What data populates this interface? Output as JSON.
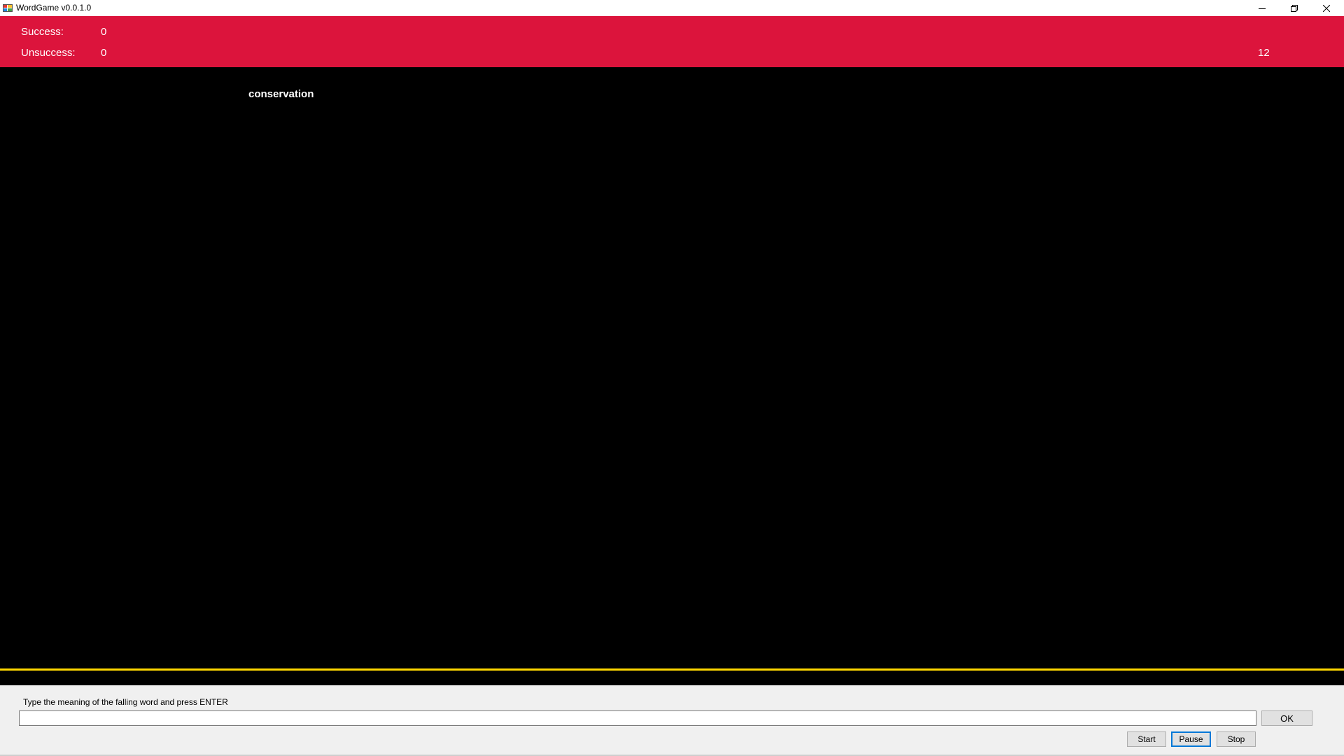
{
  "window": {
    "title": "WordGame v0.0.1.0",
    "app_icon": "app-window-icon",
    "controls": {
      "minimize_icon": "minimize-icon",
      "restore_icon": "restore-icon",
      "close_icon": "close-icon"
    }
  },
  "scoreboard": {
    "success_label": "Success:",
    "success_value": "0",
    "unsuccess_label": "Unsuccess:",
    "unsuccess_value": "0",
    "counter_value": "12",
    "background_color": "#dc143c"
  },
  "game": {
    "falling_word": "conservation",
    "background_color": "#000000",
    "ground_line_color": "#ffd700"
  },
  "input_panel": {
    "instruction": "Type the meaning of the falling word and press ENTER",
    "answer_value": "",
    "ok_label": "OK",
    "start_label": "Start",
    "pause_label": "Pause",
    "stop_label": "Stop",
    "focused_button_color": "#0078d7"
  }
}
